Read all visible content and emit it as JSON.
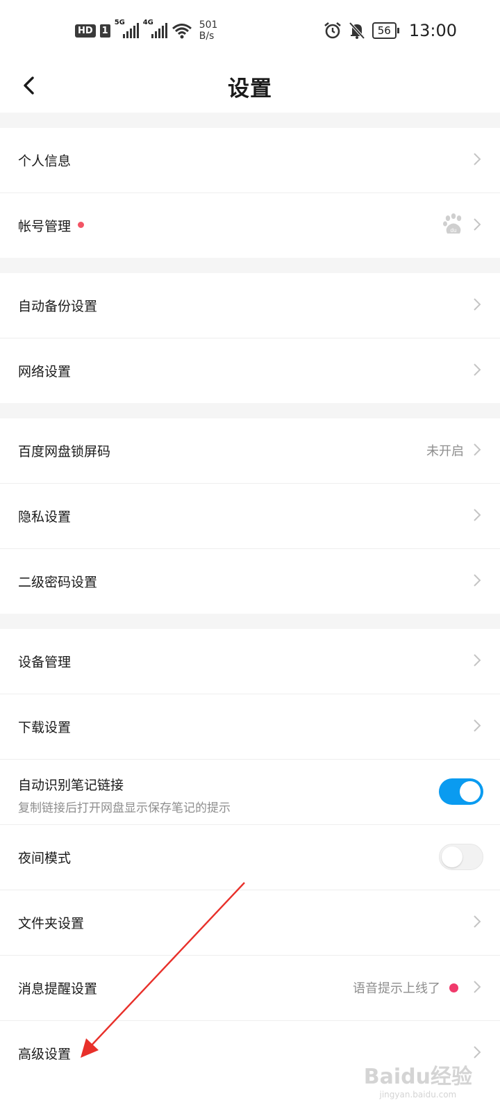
{
  "status_bar": {
    "hd_label": "HD",
    "sim_label": "1",
    "net1_label": "5G",
    "net2_label": "4G",
    "speed_value": "501",
    "speed_unit": "B/s",
    "battery": "56",
    "time": "13:00"
  },
  "header": {
    "title": "设置"
  },
  "sections": {
    "s1": {
      "personal_info": "个人信息",
      "account_manage": "帐号管理"
    },
    "s2": {
      "auto_backup": "自动备份设置",
      "network": "网络设置"
    },
    "s3": {
      "lock_code": "百度网盘锁屏码",
      "lock_code_value": "未开启",
      "privacy": "隐私设置",
      "second_password": "二级密码设置"
    },
    "s4": {
      "device_manage": "设备管理",
      "download": "下载设置",
      "note_link": "自动识别笔记链接",
      "note_link_desc": "复制链接后打开网盘显示保存笔记的提示",
      "note_link_enabled": true,
      "night_mode": "夜间模式",
      "night_mode_enabled": false,
      "folder": "文件夹设置",
      "message": "消息提醒设置",
      "message_value": "语音提示上线了",
      "advanced": "高级设置"
    }
  },
  "watermark": {
    "brand": "Baidu经验",
    "url": "jingyan.baidu.com"
  },
  "colors": {
    "accent_blue": "#0a9bf0",
    "badge_red": "#f03a6b",
    "arrow_red": "#e8302a"
  }
}
